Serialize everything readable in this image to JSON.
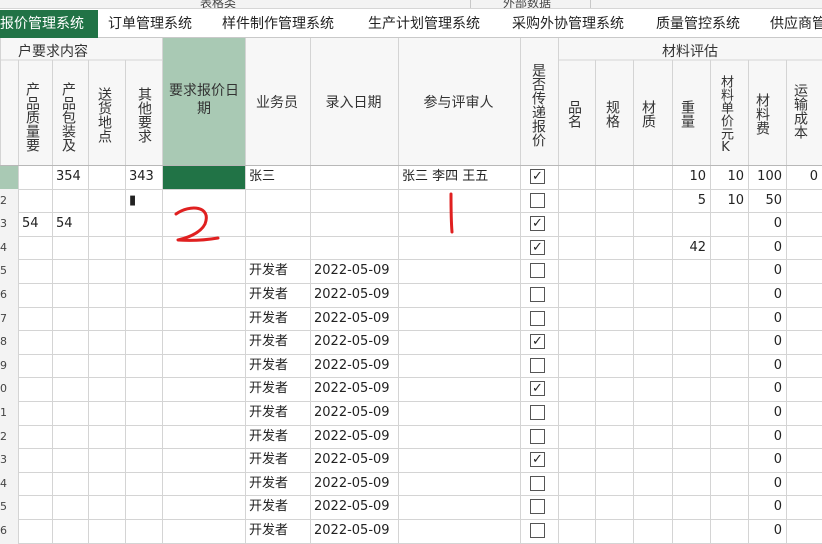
{
  "top_strip": {
    "labels": [
      "表格类",
      "外部数据"
    ]
  },
  "tabs": [
    {
      "label": "报价管理系统",
      "active": true
    },
    {
      "label": "订单管理系统",
      "active": false
    },
    {
      "label": "样件制作管理系统",
      "active": false
    },
    {
      "label": "生产计划管理系统",
      "active": false
    },
    {
      "label": "采购外协管理系统",
      "active": false
    },
    {
      "label": "质量管控系统",
      "active": false
    },
    {
      "label": "供应商管",
      "active": false
    }
  ],
  "headers": {
    "group_customer": "户要求内容",
    "group_material": "材料评估",
    "quality_req": "产品质量要",
    "packaging": "产品包装及",
    "delivery_place": "送货地点",
    "other_req": "其他要求",
    "quote_date_req": "要求报价日期",
    "salesperson": "业务员",
    "entry_date": "录入日期",
    "reviewers": "参与评审人",
    "pass_quote": "是否传递报价",
    "item_name": "品名",
    "spec": "规格",
    "material": "材质",
    "weight": "重量",
    "unit_price": "材料单价元K",
    "material_cost": "材料费",
    "shipping": "运输成本"
  },
  "rows": [
    {
      "num": "",
      "quality": "",
      "packaging": "354",
      "delivery": "",
      "other": "343",
      "salesperson": "张三",
      "date": "",
      "reviewers": "张三 李四 王五",
      "checked": true,
      "weight": "10",
      "unit_price": "10",
      "cost": "100",
      "ship": "0"
    },
    {
      "num": "2",
      "quality": "",
      "packaging": "",
      "delivery": "",
      "other": "▮",
      "salesperson": "",
      "date": "",
      "reviewers": "",
      "checked": false,
      "weight": "5",
      "unit_price": "10",
      "cost": "50",
      "ship": ""
    },
    {
      "num": "3",
      "quality": "54",
      "packaging": "54",
      "delivery": "",
      "other": "",
      "salesperson": "",
      "date": "",
      "reviewers": "",
      "checked": true,
      "weight": "",
      "unit_price": "",
      "cost": "0",
      "ship": ""
    },
    {
      "num": "4",
      "quality": "",
      "packaging": "",
      "delivery": "",
      "other": "",
      "salesperson": "",
      "date": "",
      "reviewers": "",
      "checked": true,
      "weight": "42",
      "unit_price": "",
      "cost": "0",
      "ship": ""
    },
    {
      "num": "5",
      "quality": "",
      "packaging": "",
      "delivery": "",
      "other": "",
      "salesperson": "开发者",
      "date": "2022-05-09",
      "reviewers": "",
      "checked": false,
      "weight": "",
      "unit_price": "",
      "cost": "0",
      "ship": ""
    },
    {
      "num": "6",
      "quality": "",
      "packaging": "",
      "delivery": "",
      "other": "",
      "salesperson": "开发者",
      "date": "2022-05-09",
      "reviewers": "",
      "checked": false,
      "weight": "",
      "unit_price": "",
      "cost": "0",
      "ship": ""
    },
    {
      "num": "7",
      "quality": "",
      "packaging": "",
      "delivery": "",
      "other": "",
      "salesperson": "开发者",
      "date": "2022-05-09",
      "reviewers": "",
      "checked": false,
      "weight": "",
      "unit_price": "",
      "cost": "0",
      "ship": ""
    },
    {
      "num": "8",
      "quality": "",
      "packaging": "",
      "delivery": "",
      "other": "",
      "salesperson": "开发者",
      "date": "2022-05-09",
      "reviewers": "",
      "checked": true,
      "weight": "",
      "unit_price": "",
      "cost": "0",
      "ship": ""
    },
    {
      "num": "9",
      "quality": "",
      "packaging": "",
      "delivery": "",
      "other": "",
      "salesperson": "开发者",
      "date": "2022-05-09",
      "reviewers": "",
      "checked": false,
      "weight": "",
      "unit_price": "",
      "cost": "0",
      "ship": ""
    },
    {
      "num": "0",
      "quality": "",
      "packaging": "",
      "delivery": "",
      "other": "",
      "salesperson": "开发者",
      "date": "2022-05-09",
      "reviewers": "",
      "checked": true,
      "weight": "",
      "unit_price": "",
      "cost": "0",
      "ship": ""
    },
    {
      "num": "1",
      "quality": "",
      "packaging": "",
      "delivery": "",
      "other": "",
      "salesperson": "开发者",
      "date": "2022-05-09",
      "reviewers": "",
      "checked": false,
      "weight": "",
      "unit_price": "",
      "cost": "0",
      "ship": ""
    },
    {
      "num": "2",
      "quality": "",
      "packaging": "",
      "delivery": "",
      "other": "",
      "salesperson": "开发者",
      "date": "2022-05-09",
      "reviewers": "",
      "checked": false,
      "weight": "",
      "unit_price": "",
      "cost": "0",
      "ship": ""
    },
    {
      "num": "3",
      "quality": "",
      "packaging": "",
      "delivery": "",
      "other": "",
      "salesperson": "开发者",
      "date": "2022-05-09",
      "reviewers": "",
      "checked": true,
      "weight": "",
      "unit_price": "",
      "cost": "0",
      "ship": ""
    },
    {
      "num": "4",
      "quality": "",
      "packaging": "",
      "delivery": "",
      "other": "",
      "salesperson": "开发者",
      "date": "2022-05-09",
      "reviewers": "",
      "checked": false,
      "weight": "",
      "unit_price": "",
      "cost": "0",
      "ship": ""
    },
    {
      "num": "5",
      "quality": "",
      "packaging": "",
      "delivery": "",
      "other": "",
      "salesperson": "开发者",
      "date": "2022-05-09",
      "reviewers": "",
      "checked": false,
      "weight": "",
      "unit_price": "",
      "cost": "0",
      "ship": ""
    },
    {
      "num": "6",
      "quality": "",
      "packaging": "",
      "delivery": "",
      "other": "",
      "salesperson": "开发者",
      "date": "2022-05-09",
      "reviewers": "",
      "checked": false,
      "weight": "",
      "unit_price": "",
      "cost": "0",
      "ship": ""
    }
  ],
  "annotations": {
    "mark_1": "1",
    "mark_2": "2",
    "mark_color": "#e02020"
  },
  "colors": {
    "tab_active": "#217346",
    "header_selected": "#a9c9b4",
    "cell_selected": "#217346",
    "grid_line": "#d4d4d4"
  }
}
